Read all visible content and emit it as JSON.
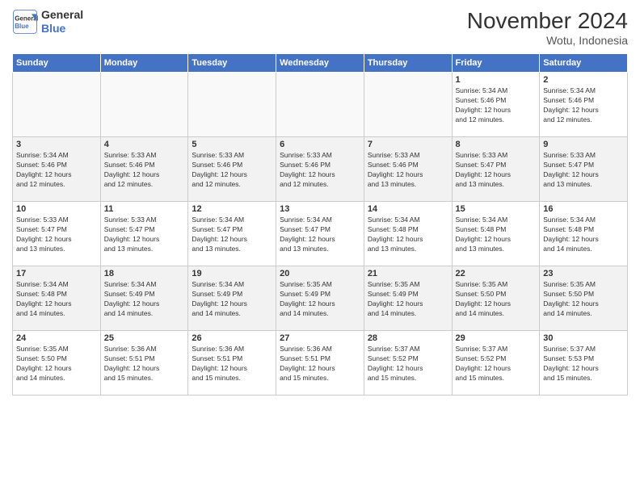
{
  "header": {
    "title": "November 2024",
    "subtitle": "Wotu, Indonesia",
    "logo_line1": "General",
    "logo_line2": "Blue"
  },
  "days_of_week": [
    "Sunday",
    "Monday",
    "Tuesday",
    "Wednesday",
    "Thursday",
    "Friday",
    "Saturday"
  ],
  "weeks": [
    [
      {
        "day": "",
        "info": ""
      },
      {
        "day": "",
        "info": ""
      },
      {
        "day": "",
        "info": ""
      },
      {
        "day": "",
        "info": ""
      },
      {
        "day": "",
        "info": ""
      },
      {
        "day": "1",
        "info": "Sunrise: 5:34 AM\nSunset: 5:46 PM\nDaylight: 12 hours\nand 12 minutes."
      },
      {
        "day": "2",
        "info": "Sunrise: 5:34 AM\nSunset: 5:46 PM\nDaylight: 12 hours\nand 12 minutes."
      }
    ],
    [
      {
        "day": "3",
        "info": "Sunrise: 5:34 AM\nSunset: 5:46 PM\nDaylight: 12 hours\nand 12 minutes."
      },
      {
        "day": "4",
        "info": "Sunrise: 5:33 AM\nSunset: 5:46 PM\nDaylight: 12 hours\nand 12 minutes."
      },
      {
        "day": "5",
        "info": "Sunrise: 5:33 AM\nSunset: 5:46 PM\nDaylight: 12 hours\nand 12 minutes."
      },
      {
        "day": "6",
        "info": "Sunrise: 5:33 AM\nSunset: 5:46 PM\nDaylight: 12 hours\nand 12 minutes."
      },
      {
        "day": "7",
        "info": "Sunrise: 5:33 AM\nSunset: 5:46 PM\nDaylight: 12 hours\nand 13 minutes."
      },
      {
        "day": "8",
        "info": "Sunrise: 5:33 AM\nSunset: 5:47 PM\nDaylight: 12 hours\nand 13 minutes."
      },
      {
        "day": "9",
        "info": "Sunrise: 5:33 AM\nSunset: 5:47 PM\nDaylight: 12 hours\nand 13 minutes."
      }
    ],
    [
      {
        "day": "10",
        "info": "Sunrise: 5:33 AM\nSunset: 5:47 PM\nDaylight: 12 hours\nand 13 minutes."
      },
      {
        "day": "11",
        "info": "Sunrise: 5:33 AM\nSunset: 5:47 PM\nDaylight: 12 hours\nand 13 minutes."
      },
      {
        "day": "12",
        "info": "Sunrise: 5:34 AM\nSunset: 5:47 PM\nDaylight: 12 hours\nand 13 minutes."
      },
      {
        "day": "13",
        "info": "Sunrise: 5:34 AM\nSunset: 5:47 PM\nDaylight: 12 hours\nand 13 minutes."
      },
      {
        "day": "14",
        "info": "Sunrise: 5:34 AM\nSunset: 5:48 PM\nDaylight: 12 hours\nand 13 minutes."
      },
      {
        "day": "15",
        "info": "Sunrise: 5:34 AM\nSunset: 5:48 PM\nDaylight: 12 hours\nand 13 minutes."
      },
      {
        "day": "16",
        "info": "Sunrise: 5:34 AM\nSunset: 5:48 PM\nDaylight: 12 hours\nand 14 minutes."
      }
    ],
    [
      {
        "day": "17",
        "info": "Sunrise: 5:34 AM\nSunset: 5:48 PM\nDaylight: 12 hours\nand 14 minutes."
      },
      {
        "day": "18",
        "info": "Sunrise: 5:34 AM\nSunset: 5:49 PM\nDaylight: 12 hours\nand 14 minutes."
      },
      {
        "day": "19",
        "info": "Sunrise: 5:34 AM\nSunset: 5:49 PM\nDaylight: 12 hours\nand 14 minutes."
      },
      {
        "day": "20",
        "info": "Sunrise: 5:35 AM\nSunset: 5:49 PM\nDaylight: 12 hours\nand 14 minutes."
      },
      {
        "day": "21",
        "info": "Sunrise: 5:35 AM\nSunset: 5:49 PM\nDaylight: 12 hours\nand 14 minutes."
      },
      {
        "day": "22",
        "info": "Sunrise: 5:35 AM\nSunset: 5:50 PM\nDaylight: 12 hours\nand 14 minutes."
      },
      {
        "day": "23",
        "info": "Sunrise: 5:35 AM\nSunset: 5:50 PM\nDaylight: 12 hours\nand 14 minutes."
      }
    ],
    [
      {
        "day": "24",
        "info": "Sunrise: 5:35 AM\nSunset: 5:50 PM\nDaylight: 12 hours\nand 14 minutes."
      },
      {
        "day": "25",
        "info": "Sunrise: 5:36 AM\nSunset: 5:51 PM\nDaylight: 12 hours\nand 15 minutes."
      },
      {
        "day": "26",
        "info": "Sunrise: 5:36 AM\nSunset: 5:51 PM\nDaylight: 12 hours\nand 15 minutes."
      },
      {
        "day": "27",
        "info": "Sunrise: 5:36 AM\nSunset: 5:51 PM\nDaylight: 12 hours\nand 15 minutes."
      },
      {
        "day": "28",
        "info": "Sunrise: 5:37 AM\nSunset: 5:52 PM\nDaylight: 12 hours\nand 15 minutes."
      },
      {
        "day": "29",
        "info": "Sunrise: 5:37 AM\nSunset: 5:52 PM\nDaylight: 12 hours\nand 15 minutes."
      },
      {
        "day": "30",
        "info": "Sunrise: 5:37 AM\nSunset: 5:53 PM\nDaylight: 12 hours\nand 15 minutes."
      }
    ]
  ],
  "accent_color": "#4472C4"
}
